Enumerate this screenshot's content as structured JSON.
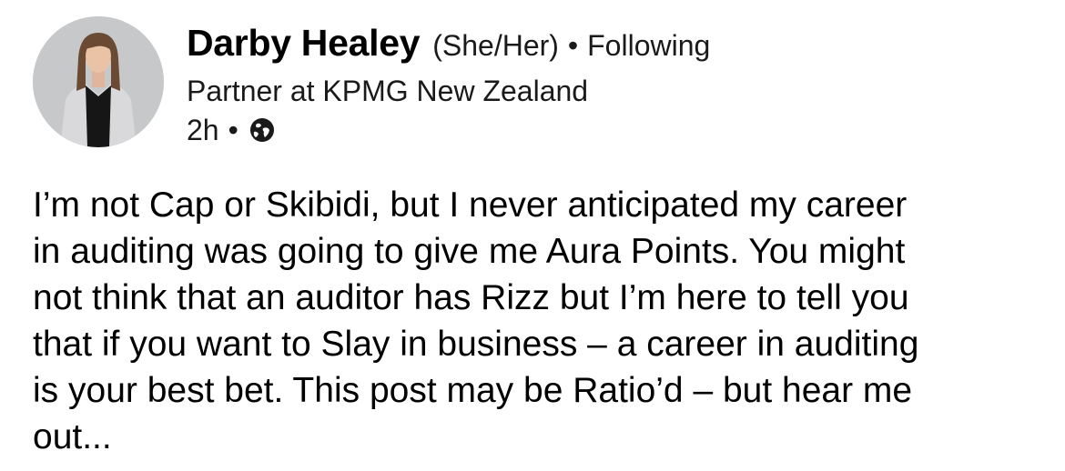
{
  "author": {
    "name": "Darby Healey",
    "pronouns": "(She/Her)",
    "follow_status": "Following",
    "headline": "Partner at KPMG New Zealand",
    "avatar_icon": "profile-photo"
  },
  "meta": {
    "time": "2h",
    "visibility_icon": "globe-icon"
  },
  "separator": "•",
  "post": {
    "lines": [
      "I’m not Cap or Skibidi, but I never anticipated my career",
      "in auditing was going to give me Aura Points. You might",
      "not think that an auditor has Rizz but I’m here to tell you",
      "that if you want to Slay in business – a career in auditing",
      "is your best bet. This post may be Ratio’d – but hear me",
      "out..."
    ]
  },
  "colors": {
    "background": "#ffffff",
    "text": "#000000",
    "secondary_text": "#1a1a1a"
  }
}
